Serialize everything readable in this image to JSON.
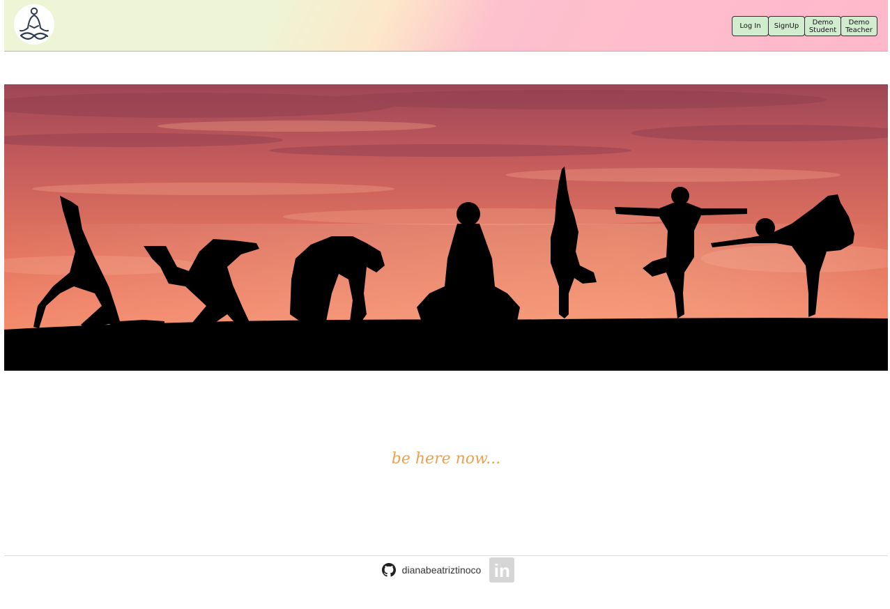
{
  "navbar": {
    "logo_icon": "meditation-figure-icon",
    "colors": {
      "gradient_start": "#eef5d6",
      "gradient_end": "#ffb8cb",
      "button_bg": "#d2ecd0"
    },
    "buttons": {
      "login": "Log In",
      "signup": "SignUp",
      "demo_student": "Demo Student",
      "demo_teacher": "Demo Teacher"
    }
  },
  "hero": {
    "image": "sunset-yoga-silhouettes",
    "colors": {
      "sky_top": "#b14f58",
      "sky_bottom": "#f08068",
      "ground": "#000000"
    }
  },
  "tagline": {
    "text": "be here now...",
    "color": "#e9a257"
  },
  "footer": {
    "github_icon": "github-icon",
    "github_username": "dianabeatriztinoco",
    "linkedin_icon": "linkedin-icon",
    "linkedin_text": "in"
  }
}
